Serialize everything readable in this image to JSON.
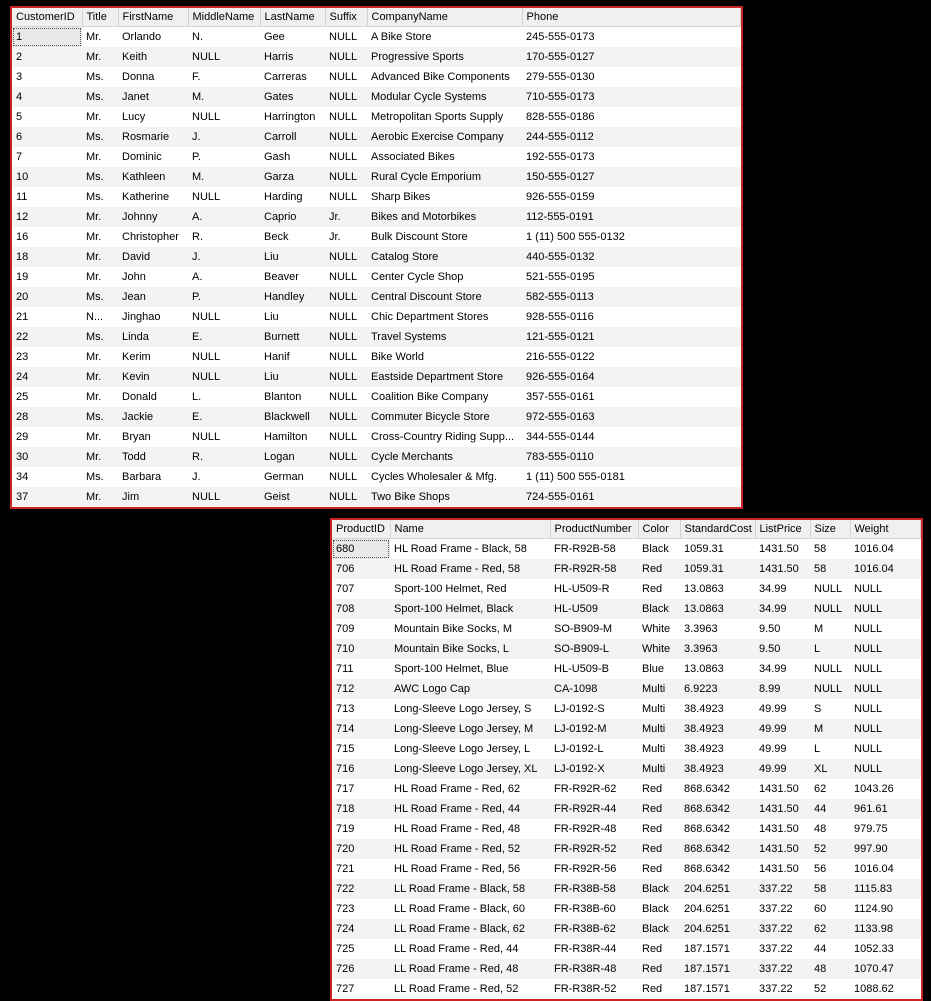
{
  "customers": {
    "headers": [
      "CustomerID",
      "Title",
      "FirstName",
      "MiddleName",
      "LastName",
      "Suffix",
      "CompanyName",
      "Phone"
    ],
    "rows": [
      {
        "CustomerID": "1",
        "Title": "Mr.",
        "FirstName": "Orlando",
        "MiddleName": "N.",
        "LastName": "Gee",
        "Suffix": "NULL",
        "CompanyName": "A Bike Store",
        "Phone": "245-555-0173"
      },
      {
        "CustomerID": "2",
        "Title": "Mr.",
        "FirstName": "Keith",
        "MiddleName": "NULL",
        "LastName": "Harris",
        "Suffix": "NULL",
        "CompanyName": "Progressive Sports",
        "Phone": "170-555-0127"
      },
      {
        "CustomerID": "3",
        "Title": "Ms.",
        "FirstName": "Donna",
        "MiddleName": "F.",
        "LastName": "Carreras",
        "Suffix": "NULL",
        "CompanyName": "Advanced Bike Components",
        "Phone": "279-555-0130"
      },
      {
        "CustomerID": "4",
        "Title": "Ms.",
        "FirstName": "Janet",
        "MiddleName": "M.",
        "LastName": "Gates",
        "Suffix": "NULL",
        "CompanyName": "Modular Cycle Systems",
        "Phone": "710-555-0173"
      },
      {
        "CustomerID": "5",
        "Title": "Mr.",
        "FirstName": "Lucy",
        "MiddleName": "NULL",
        "LastName": "Harrington",
        "Suffix": "NULL",
        "CompanyName": "Metropolitan Sports Supply",
        "Phone": "828-555-0186"
      },
      {
        "CustomerID": "6",
        "Title": "Ms.",
        "FirstName": "Rosmarie",
        "MiddleName": "J.",
        "LastName": "Carroll",
        "Suffix": "NULL",
        "CompanyName": "Aerobic Exercise Company",
        "Phone": "244-555-0112"
      },
      {
        "CustomerID": "7",
        "Title": "Mr.",
        "FirstName": "Dominic",
        "MiddleName": "P.",
        "LastName": "Gash",
        "Suffix": "NULL",
        "CompanyName": "Associated Bikes",
        "Phone": "192-555-0173"
      },
      {
        "CustomerID": "10",
        "Title": "Ms.",
        "FirstName": "Kathleen",
        "MiddleName": "M.",
        "LastName": "Garza",
        "Suffix": "NULL",
        "CompanyName": "Rural Cycle Emporium",
        "Phone": "150-555-0127"
      },
      {
        "CustomerID": "11",
        "Title": "Ms.",
        "FirstName": "Katherine",
        "MiddleName": "NULL",
        "LastName": "Harding",
        "Suffix": "NULL",
        "CompanyName": "Sharp Bikes",
        "Phone": "926-555-0159"
      },
      {
        "CustomerID": "12",
        "Title": "Mr.",
        "FirstName": "Johnny",
        "MiddleName": "A.",
        "LastName": "Caprio",
        "Suffix": "Jr.",
        "CompanyName": "Bikes and Motorbikes",
        "Phone": "112-555-0191"
      },
      {
        "CustomerID": "16",
        "Title": "Mr.",
        "FirstName": "Christopher",
        "MiddleName": "R.",
        "LastName": "Beck",
        "Suffix": "Jr.",
        "CompanyName": "Bulk Discount Store",
        "Phone": "1 (11) 500 555-0132"
      },
      {
        "CustomerID": "18",
        "Title": "Mr.",
        "FirstName": "David",
        "MiddleName": "J.",
        "LastName": "Liu",
        "Suffix": "NULL",
        "CompanyName": "Catalog Store",
        "Phone": "440-555-0132"
      },
      {
        "CustomerID": "19",
        "Title": "Mr.",
        "FirstName": "John",
        "MiddleName": "A.",
        "LastName": "Beaver",
        "Suffix": "NULL",
        "CompanyName": "Center Cycle Shop",
        "Phone": "521-555-0195"
      },
      {
        "CustomerID": "20",
        "Title": "Ms.",
        "FirstName": "Jean",
        "MiddleName": "P.",
        "LastName": "Handley",
        "Suffix": "NULL",
        "CompanyName": "Central Discount Store",
        "Phone": "582-555-0113"
      },
      {
        "CustomerID": "21",
        "Title": "N...",
        "FirstName": "Jinghao",
        "MiddleName": "NULL",
        "LastName": "Liu",
        "Suffix": "NULL",
        "CompanyName": "Chic Department Stores",
        "Phone": "928-555-0116"
      },
      {
        "CustomerID": "22",
        "Title": "Ms.",
        "FirstName": "Linda",
        "MiddleName": "E.",
        "LastName": "Burnett",
        "Suffix": "NULL",
        "CompanyName": "Travel Systems",
        "Phone": "121-555-0121"
      },
      {
        "CustomerID": "23",
        "Title": "Mr.",
        "FirstName": "Kerim",
        "MiddleName": "NULL",
        "LastName": "Hanif",
        "Suffix": "NULL",
        "CompanyName": "Bike World",
        "Phone": "216-555-0122"
      },
      {
        "CustomerID": "24",
        "Title": "Mr.",
        "FirstName": "Kevin",
        "MiddleName": "NULL",
        "LastName": "Liu",
        "Suffix": "NULL",
        "CompanyName": "Eastside Department Store",
        "Phone": "926-555-0164"
      },
      {
        "CustomerID": "25",
        "Title": "Mr.",
        "FirstName": "Donald",
        "MiddleName": "L.",
        "LastName": "Blanton",
        "Suffix": "NULL",
        "CompanyName": "Coalition Bike Company",
        "Phone": "357-555-0161"
      },
      {
        "CustomerID": "28",
        "Title": "Ms.",
        "FirstName": "Jackie",
        "MiddleName": "E.",
        "LastName": "Blackwell",
        "Suffix": "NULL",
        "CompanyName": "Commuter Bicycle Store",
        "Phone": "972-555-0163"
      },
      {
        "CustomerID": "29",
        "Title": "Mr.",
        "FirstName": "Bryan",
        "MiddleName": "NULL",
        "LastName": "Hamilton",
        "Suffix": "NULL",
        "CompanyName": "Cross-Country Riding Supp...",
        "Phone": "344-555-0144"
      },
      {
        "CustomerID": "30",
        "Title": "Mr.",
        "FirstName": "Todd",
        "MiddleName": "R.",
        "LastName": "Logan",
        "Suffix": "NULL",
        "CompanyName": "Cycle Merchants",
        "Phone": "783-555-0110"
      },
      {
        "CustomerID": "34",
        "Title": "Ms.",
        "FirstName": "Barbara",
        "MiddleName": "J.",
        "LastName": "German",
        "Suffix": "NULL",
        "CompanyName": "Cycles Wholesaler & Mfg.",
        "Phone": "1 (11) 500 555-0181"
      },
      {
        "CustomerID": "37",
        "Title": "Mr.",
        "FirstName": "Jim",
        "MiddleName": "NULL",
        "LastName": "Geist",
        "Suffix": "NULL",
        "CompanyName": "Two Bike Shops",
        "Phone": "724-555-0161"
      }
    ]
  },
  "products": {
    "headers": [
      "ProductID",
      "Name",
      "ProductNumber",
      "Color",
      "StandardCost",
      "ListPrice",
      "Size",
      "Weight"
    ],
    "rows": [
      {
        "ProductID": "680",
        "Name": "HL Road Frame - Black, 58",
        "ProductNumber": "FR-R92B-58",
        "Color": "Black",
        "StandardCost": "1059.31",
        "ListPrice": "1431.50",
        "Size": "58",
        "Weight": "1016.04"
      },
      {
        "ProductID": "706",
        "Name": "HL Road Frame - Red, 58",
        "ProductNumber": "FR-R92R-58",
        "Color": "Red",
        "StandardCost": "1059.31",
        "ListPrice": "1431.50",
        "Size": "58",
        "Weight": "1016.04"
      },
      {
        "ProductID": "707",
        "Name": "Sport-100 Helmet, Red",
        "ProductNumber": "HL-U509-R",
        "Color": "Red",
        "StandardCost": "13.0863",
        "ListPrice": "34.99",
        "Size": "NULL",
        "Weight": "NULL"
      },
      {
        "ProductID": "708",
        "Name": "Sport-100 Helmet, Black",
        "ProductNumber": "HL-U509",
        "Color": "Black",
        "StandardCost": "13.0863",
        "ListPrice": "34.99",
        "Size": "NULL",
        "Weight": "NULL"
      },
      {
        "ProductID": "709",
        "Name": "Mountain Bike Socks, M",
        "ProductNumber": "SO-B909-M",
        "Color": "White",
        "StandardCost": "3.3963",
        "ListPrice": "9.50",
        "Size": "M",
        "Weight": "NULL"
      },
      {
        "ProductID": "710",
        "Name": "Mountain Bike Socks, L",
        "ProductNumber": "SO-B909-L",
        "Color": "White",
        "StandardCost": "3.3963",
        "ListPrice": "9.50",
        "Size": "L",
        "Weight": "NULL"
      },
      {
        "ProductID": "711",
        "Name": "Sport-100 Helmet, Blue",
        "ProductNumber": "HL-U509-B",
        "Color": "Blue",
        "StandardCost": "13.0863",
        "ListPrice": "34.99",
        "Size": "NULL",
        "Weight": "NULL"
      },
      {
        "ProductID": "712",
        "Name": "AWC Logo Cap",
        "ProductNumber": "CA-1098",
        "Color": "Multi",
        "StandardCost": "6.9223",
        "ListPrice": "8.99",
        "Size": "NULL",
        "Weight": "NULL"
      },
      {
        "ProductID": "713",
        "Name": "Long-Sleeve Logo Jersey, S",
        "ProductNumber": "LJ-0192-S",
        "Color": "Multi",
        "StandardCost": "38.4923",
        "ListPrice": "49.99",
        "Size": "S",
        "Weight": "NULL"
      },
      {
        "ProductID": "714",
        "Name": "Long-Sleeve Logo Jersey, M",
        "ProductNumber": "LJ-0192-M",
        "Color": "Multi",
        "StandardCost": "38.4923",
        "ListPrice": "49.99",
        "Size": "M",
        "Weight": "NULL"
      },
      {
        "ProductID": "715",
        "Name": "Long-Sleeve Logo Jersey, L",
        "ProductNumber": "LJ-0192-L",
        "Color": "Multi",
        "StandardCost": "38.4923",
        "ListPrice": "49.99",
        "Size": "L",
        "Weight": "NULL"
      },
      {
        "ProductID": "716",
        "Name": "Long-Sleeve Logo Jersey, XL",
        "ProductNumber": "LJ-0192-X",
        "Color": "Multi",
        "StandardCost": "38.4923",
        "ListPrice": "49.99",
        "Size": "XL",
        "Weight": "NULL"
      },
      {
        "ProductID": "717",
        "Name": "HL Road Frame - Red, 62",
        "ProductNumber": "FR-R92R-62",
        "Color": "Red",
        "StandardCost": "868.6342",
        "ListPrice": "1431.50",
        "Size": "62",
        "Weight": "1043.26"
      },
      {
        "ProductID": "718",
        "Name": "HL Road Frame - Red, 44",
        "ProductNumber": "FR-R92R-44",
        "Color": "Red",
        "StandardCost": "868.6342",
        "ListPrice": "1431.50",
        "Size": "44",
        "Weight": "961.61"
      },
      {
        "ProductID": "719",
        "Name": "HL Road Frame - Red, 48",
        "ProductNumber": "FR-R92R-48",
        "Color": "Red",
        "StandardCost": "868.6342",
        "ListPrice": "1431.50",
        "Size": "48",
        "Weight": "979.75"
      },
      {
        "ProductID": "720",
        "Name": "HL Road Frame - Red, 52",
        "ProductNumber": "FR-R92R-52",
        "Color": "Red",
        "StandardCost": "868.6342",
        "ListPrice": "1431.50",
        "Size": "52",
        "Weight": "997.90"
      },
      {
        "ProductID": "721",
        "Name": "HL Road Frame - Red, 56",
        "ProductNumber": "FR-R92R-56",
        "Color": "Red",
        "StandardCost": "868.6342",
        "ListPrice": "1431.50",
        "Size": "56",
        "Weight": "1016.04"
      },
      {
        "ProductID": "722",
        "Name": "LL Road Frame - Black, 58",
        "ProductNumber": "FR-R38B-58",
        "Color": "Black",
        "StandardCost": "204.6251",
        "ListPrice": "337.22",
        "Size": "58",
        "Weight": "1115.83"
      },
      {
        "ProductID": "723",
        "Name": "LL Road Frame - Black, 60",
        "ProductNumber": "FR-R38B-60",
        "Color": "Black",
        "StandardCost": "204.6251",
        "ListPrice": "337.22",
        "Size": "60",
        "Weight": "1124.90"
      },
      {
        "ProductID": "724",
        "Name": "LL Road Frame - Black, 62",
        "ProductNumber": "FR-R38B-62",
        "Color": "Black",
        "StandardCost": "204.6251",
        "ListPrice": "337.22",
        "Size": "62",
        "Weight": "1133.98"
      },
      {
        "ProductID": "725",
        "Name": "LL Road Frame - Red, 44",
        "ProductNumber": "FR-R38R-44",
        "Color": "Red",
        "StandardCost": "187.1571",
        "ListPrice": "337.22",
        "Size": "44",
        "Weight": "1052.33"
      },
      {
        "ProductID": "726",
        "Name": "LL Road Frame - Red, 48",
        "ProductNumber": "FR-R38R-48",
        "Color": "Red",
        "StandardCost": "187.1571",
        "ListPrice": "337.22",
        "Size": "48",
        "Weight": "1070.47"
      },
      {
        "ProductID": "727",
        "Name": "LL Road Frame - Red, 52",
        "ProductNumber": "FR-R38R-52",
        "Color": "Red",
        "StandardCost": "187.1571",
        "ListPrice": "337.22",
        "Size": "52",
        "Weight": "1088.62"
      }
    ]
  }
}
